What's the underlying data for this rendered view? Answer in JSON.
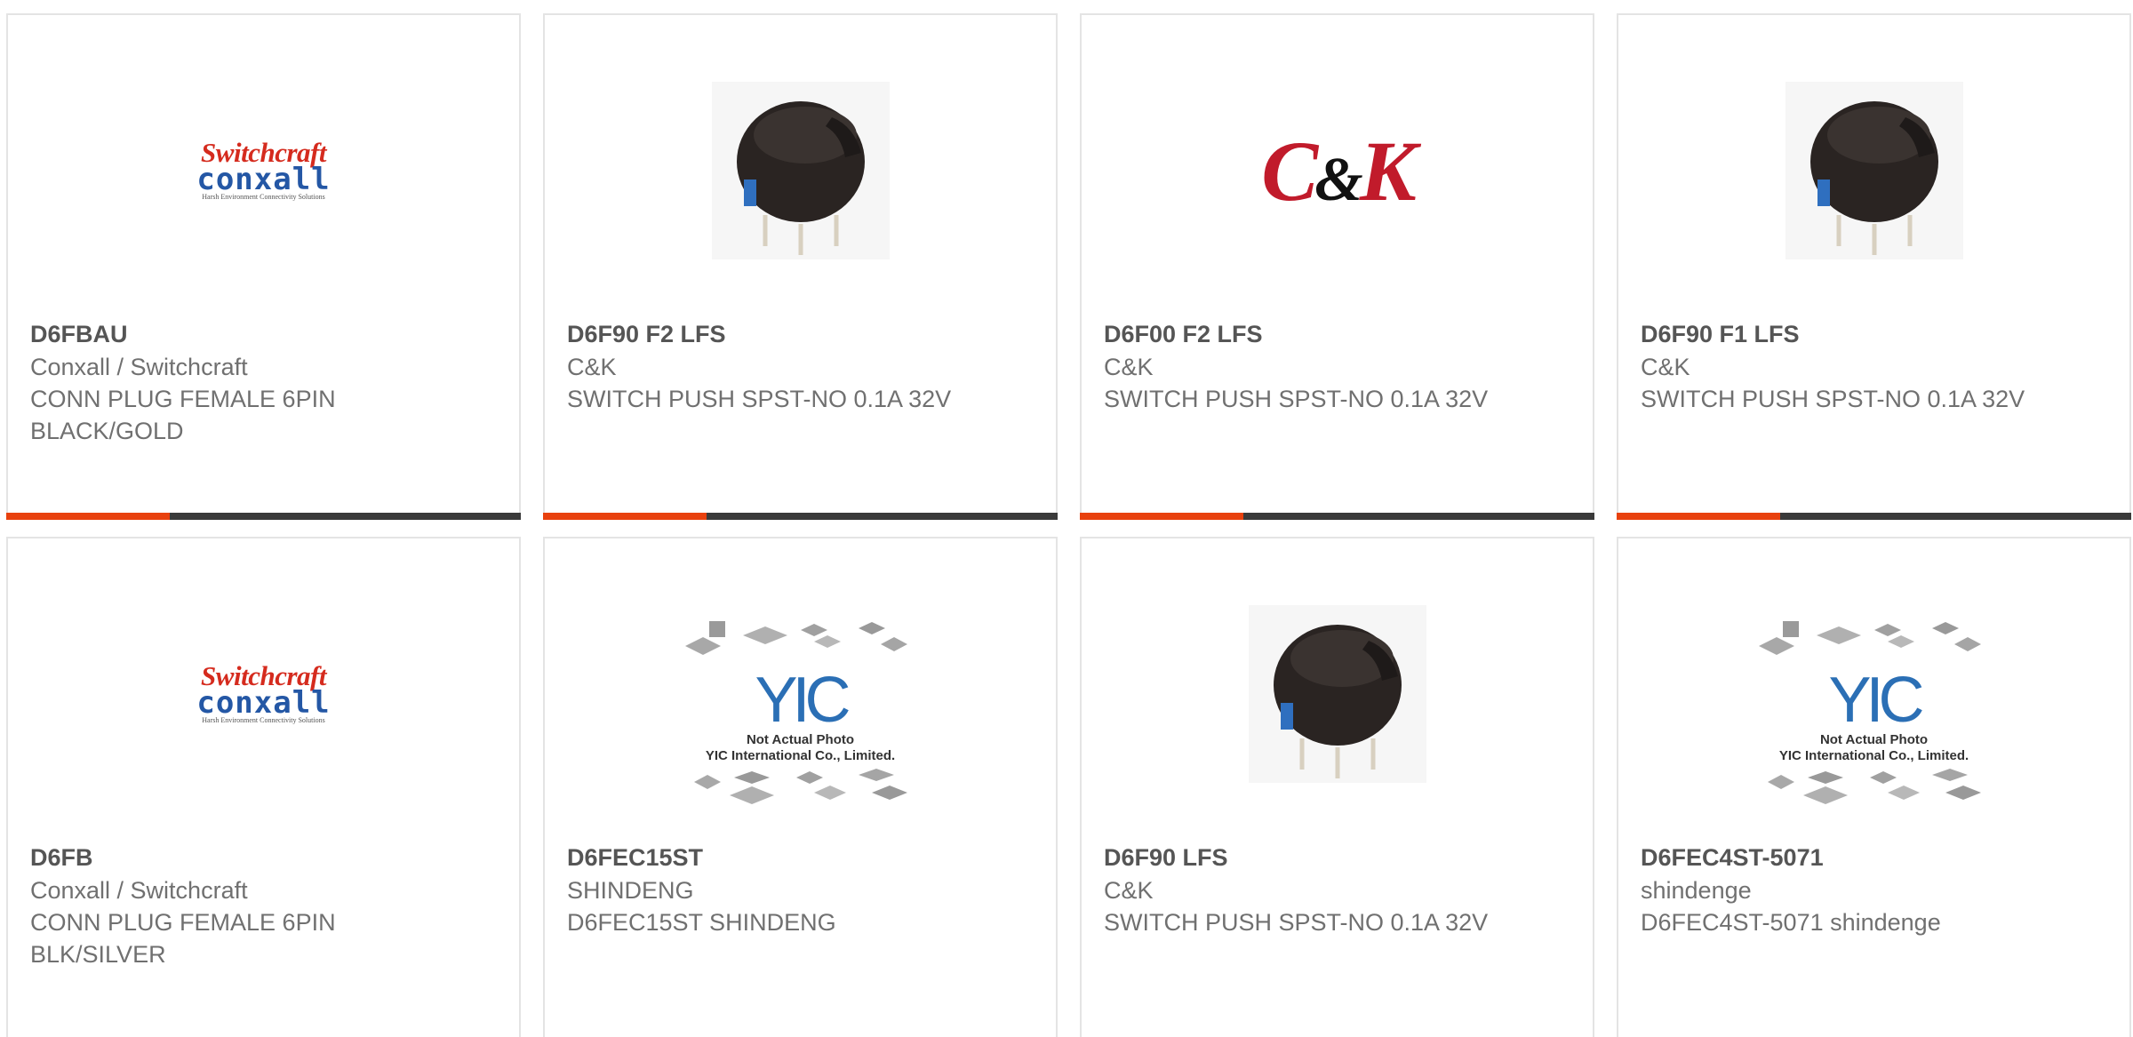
{
  "products": [
    {
      "part": "D6FBAU",
      "manufacturer": "Conxall / Switchcraft",
      "description": "CONN PLUG FEMALE 6PIN BLACK/GOLD",
      "image": "switchcraft-conxall-logo"
    },
    {
      "part": "D6F90 F2 LFS",
      "manufacturer": "C&K",
      "description": "SWITCH PUSH SPST-NO 0.1A 32V",
      "image": "push-switch-photo"
    },
    {
      "part": "D6F00 F2 LFS",
      "manufacturer": "C&K",
      "description": "SWITCH PUSH SPST-NO 0.1A 32V",
      "image": "ck-logo"
    },
    {
      "part": "D6F90 F1 LFS",
      "manufacturer": "C&K",
      "description": "SWITCH PUSH SPST-NO 0.1A 32V",
      "image": "push-switch-photo"
    },
    {
      "part": "D6FB",
      "manufacturer": "Conxall / Switchcraft",
      "description": "CONN PLUG FEMALE 6PIN BLK/SILVER",
      "image": "switchcraft-conxall-logo"
    },
    {
      "part": "D6FEC15ST",
      "manufacturer": "SHINDENG",
      "description": "D6FEC15ST SHINDENG",
      "image": "not-actual-photo"
    },
    {
      "part": "D6F90 LFS",
      "manufacturer": "C&K",
      "description": "SWITCH PUSH SPST-NO 0.1A 32V",
      "image": "push-switch-photo"
    },
    {
      "part": "D6FEC4ST-5071",
      "manufacturer": "shindenge",
      "description": "D6FEC4ST-5071 shindenge",
      "image": "not-actual-photo"
    }
  ],
  "logos": {
    "switchcraft": {
      "top": "Switchcraft",
      "bottom": "conxall",
      "tagline": "Harsh Environment Connectivity Solutions"
    },
    "ck": {
      "left": "C",
      "amp": "&",
      "right": "K"
    },
    "placeholder": {
      "mark": "YIC",
      "line1": "Not Actual Photo",
      "line2": "YIC International Co., Limited."
    }
  },
  "colors": {
    "accent": "#e8410e",
    "bar": "#3a3a3a",
    "ck_red": "#c11b2b",
    "switchcraft_red": "#d52b1e",
    "conxall_blue": "#2457a5",
    "yic_blue": "#2b6fb5"
  }
}
